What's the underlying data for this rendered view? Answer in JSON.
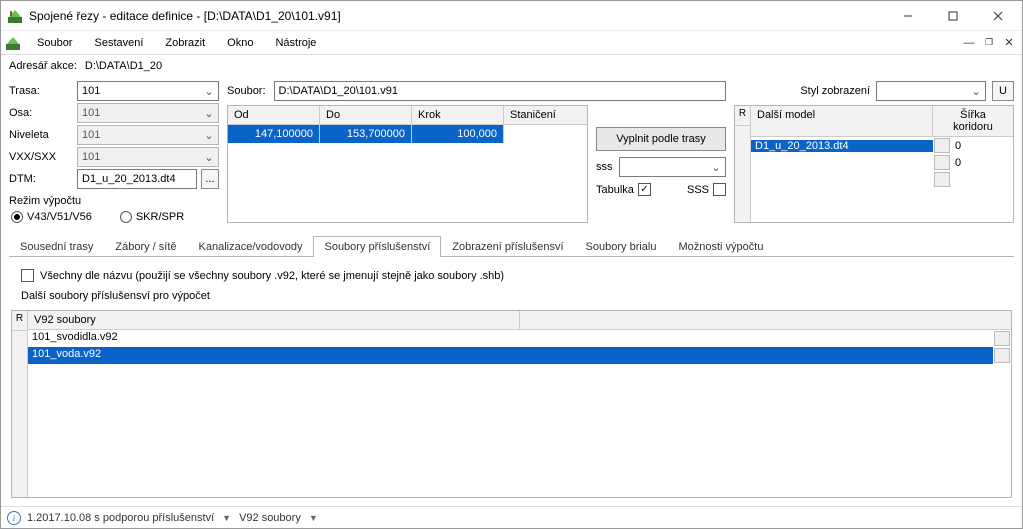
{
  "window": {
    "title": "Spojené řezy - editace definice - [D:\\DATA\\D1_20\\101.v91]"
  },
  "menu": {
    "items": [
      "Soubor",
      "Sestavení",
      "Zobrazit",
      "Okno",
      "Nástroje"
    ]
  },
  "pathbar": {
    "label": "Adresář akce:",
    "value": "D:\\DATA\\D1_20"
  },
  "left": {
    "trasa_label": "Trasa:",
    "trasa_value": "101",
    "osa_label": "Osa:",
    "osa_value": "101",
    "niveleta_label": "Niveleta",
    "niveleta_value": "101",
    "vxx_label": "VXX/SXX",
    "vxx_value": "101",
    "dtm_label": "DTM:",
    "dtm_value": "D1_u_20_2013.dt4",
    "dtm_browse": "...",
    "rezim_label": "Režim výpočtu",
    "radio1": "V43/V51/V56",
    "radio2": "SKR/SPR"
  },
  "center": {
    "soubor_label": "Soubor:",
    "soubor_value": "D:\\DATA\\D1_20\\101.v91",
    "headers": {
      "od": "Od",
      "do": "Do",
      "krok": "Krok",
      "stan": "Staničení"
    },
    "row": {
      "od": "147,100000",
      "do": "153,700000",
      "krok": "100,000",
      "stan": ""
    }
  },
  "rside": {
    "btn_fill": "Vyplnit podle trasy",
    "sss_label": "sss",
    "tabulka_label": "Tabulka",
    "sss_chk_label": "SSS"
  },
  "far": {
    "styl_label": "Styl zobrazení",
    "u_btn": "U",
    "hdr_r": "R",
    "hdr_model": "Další model",
    "hdr_width": "Šířka koridoru",
    "rows": [
      {
        "model": "D1_u_20_2013.dt4",
        "width": "0"
      },
      {
        "model": "",
        "width": "0"
      },
      {
        "model": "",
        "width": ""
      }
    ]
  },
  "tabs": {
    "t1": "Sousední trasy",
    "t2": "Zábory / sítě",
    "t3": "Kanalizace/vodovody",
    "t4": "Soubory příslušenství",
    "t5": "Zobrazení příslušensví",
    "t6": "Soubory brialu",
    "t7": "Možnosti výpočtu"
  },
  "tabcontent": {
    "chk_all": "Všechny dle názvu (použijí se všechny soubory .v92, které se jmenují stejně jako soubory .shb)",
    "more_label": "Další soubory příslušensví pro výpočet",
    "hdr_r": "R",
    "hdr_files": "V92 soubory",
    "rows": [
      "101_svodidla.v92",
      "101_voda.v92"
    ]
  },
  "status": {
    "version": "1.2017.10.08 s podporou příslušenství",
    "right": "V92 soubory"
  }
}
